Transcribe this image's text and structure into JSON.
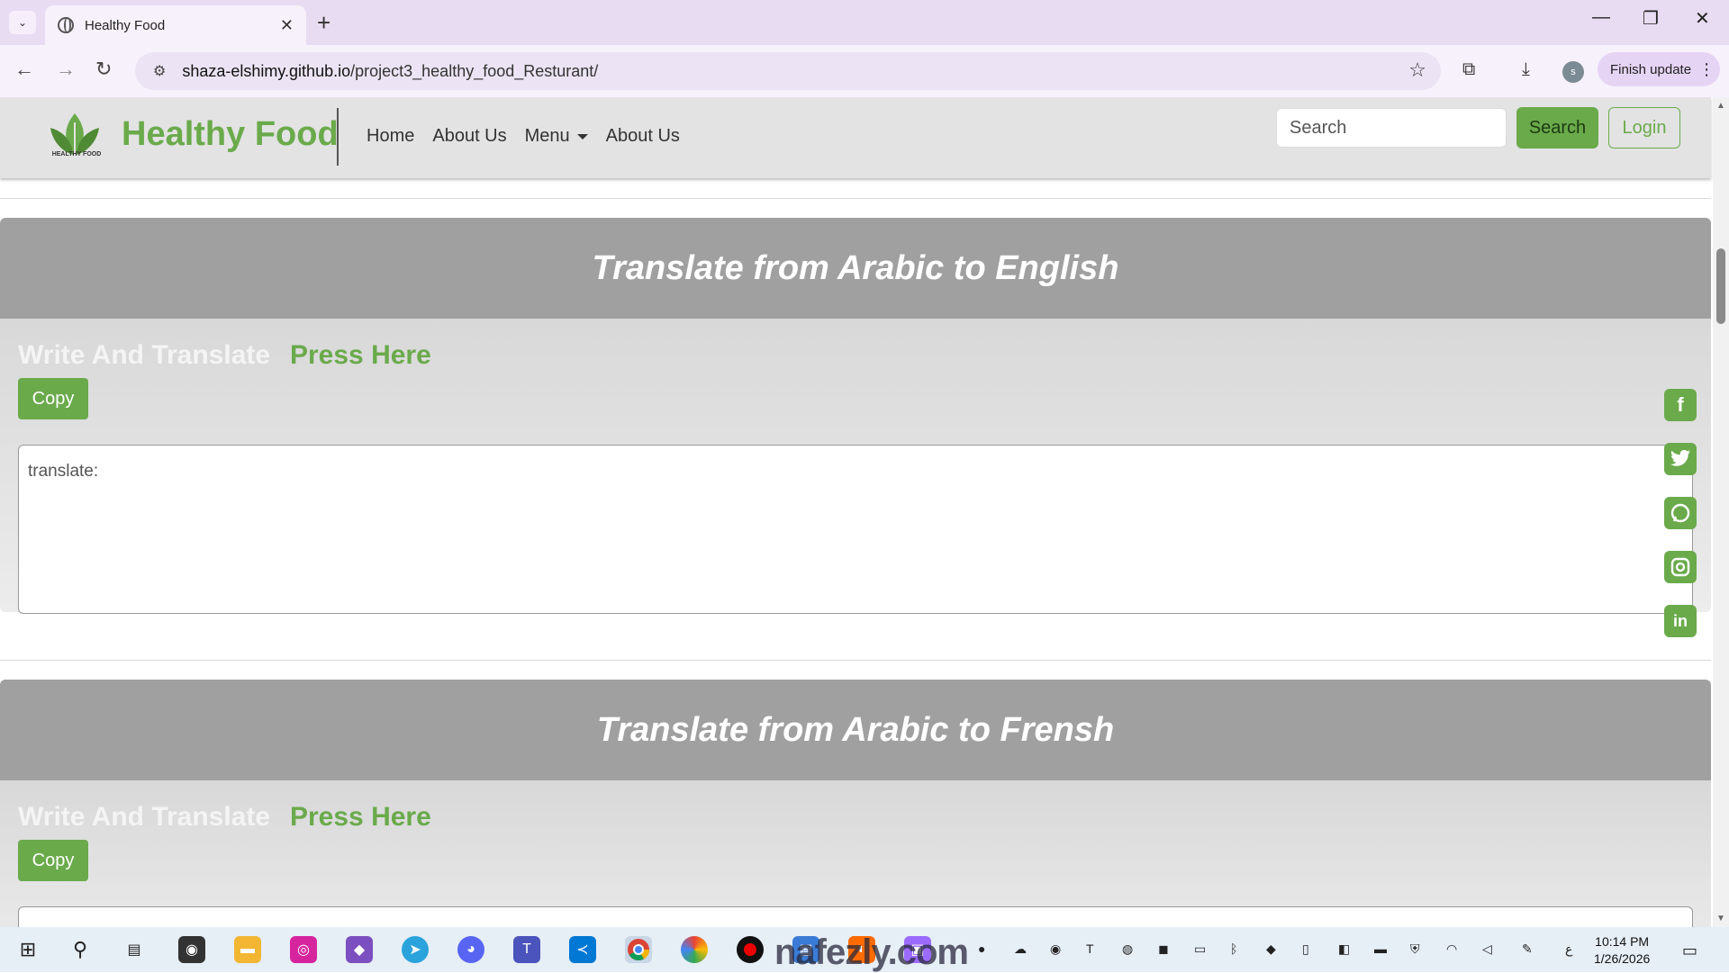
{
  "browser": {
    "tab_title": "Healthy Food",
    "url_host": "shaza-elshimy.github.io",
    "url_path": "/project3_healthy_food_Resturant/",
    "finish_update": "Finish update",
    "avatar_letter": "s"
  },
  "site": {
    "brand": "Healthy Food",
    "logo_caption": "HEALTHY FOOD",
    "nav": {
      "home": "Home",
      "about1": "About Us",
      "menu": "Menu",
      "about2": "About Us"
    },
    "search_placeholder": "Search",
    "search_button": "Search",
    "login_button": "Login"
  },
  "sections": [
    {
      "title": "Translate from Arabic to English",
      "write_label": "Write And Translate",
      "press_label": "Press Here",
      "copy_label": "Copy",
      "textarea_text": "translate:"
    },
    {
      "title": "Translate from Arabic to Frensh",
      "write_label": "Write And Translate",
      "press_label": "Press Here",
      "copy_label": "Copy"
    }
  ],
  "social_icons": [
    "facebook-icon",
    "twitter-icon",
    "whatsapp-icon",
    "instagram-icon",
    "linkedin-icon"
  ],
  "taskbar": {
    "time": "10:14 PM",
    "date": "1/26/2026",
    "watermark": "nafezly.com"
  },
  "colors": {
    "brand_green": "#6aaa4b",
    "section_header": "#a0a0a0",
    "tabstrip": "#e8dcf2"
  }
}
